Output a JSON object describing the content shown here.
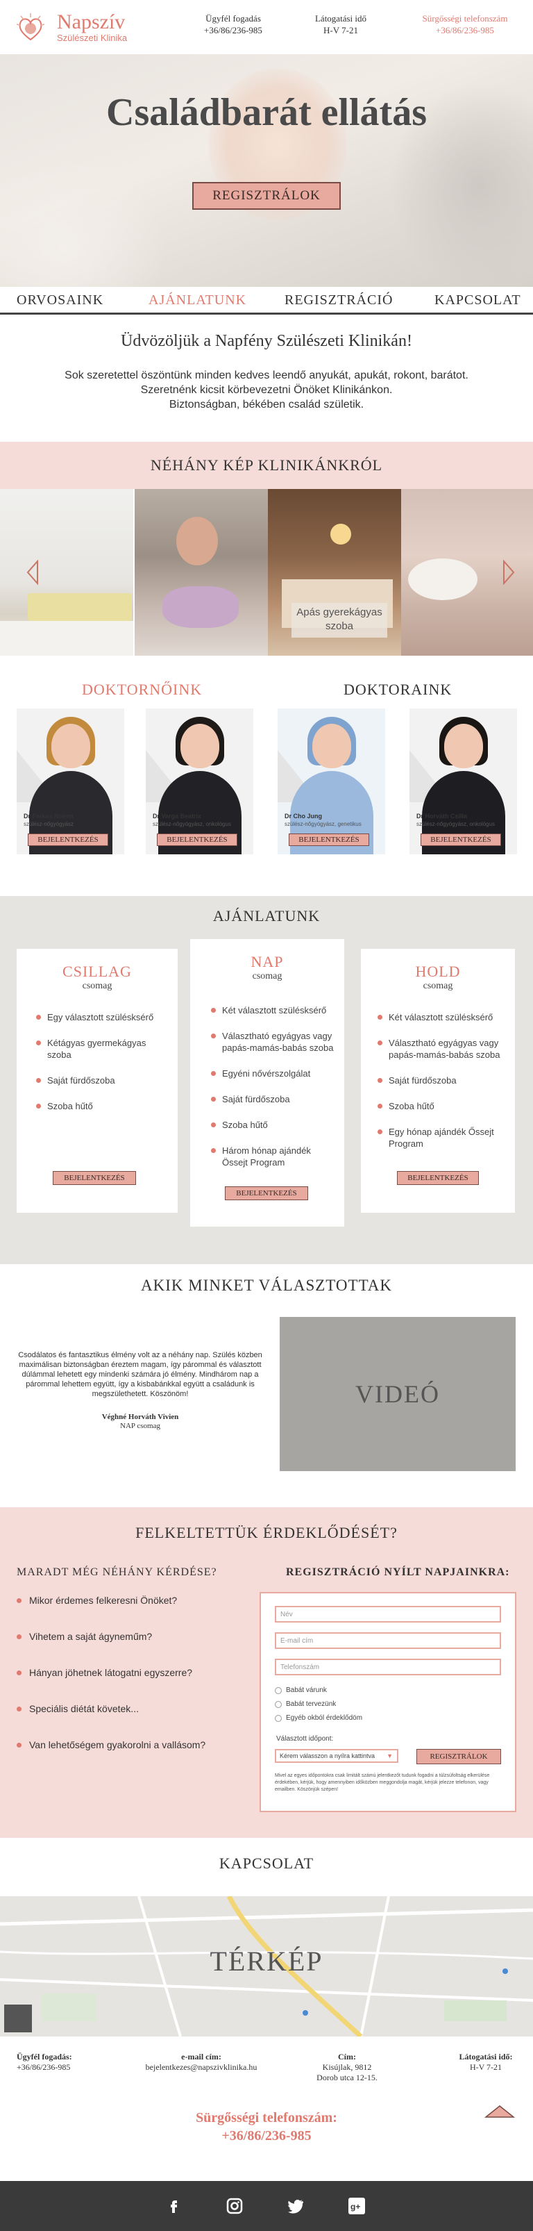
{
  "header": {
    "logo_name": "Napszív",
    "logo_sub": "Szülészeti Klinika",
    "reception_label": "Ügyfél fogadás",
    "reception_phone": "+36/86/236-985",
    "visiting_label": "Látogatási idő",
    "visiting_time": "H-V 7-21",
    "emergency_label": "Sürgősségi telefonszám",
    "emergency_phone": "+36/86/236-985"
  },
  "hero": {
    "title": "Családbarát ellátás",
    "button": "REGISZTRÁLOK"
  },
  "nav": {
    "items": [
      "ORVOSAINK",
      "AJÁNLATUNK",
      "REGISZTRÁCIÓ",
      "KAPCSOLAT"
    ],
    "active": "AJÁNLATUNK"
  },
  "welcome": {
    "title": "Üdvözöljük a Napfény Szülészeti Klinikán!",
    "line1": "Sok szeretettel öszöntünk minden kedves leendő anyukát, apukát, rokont, barátot.",
    "line2": "Szeretnénk kicsit körbevezetni Önöket Klinikánkon.",
    "line3": "Biztonságban, békében család születik."
  },
  "gallery": {
    "title": "NÉHÁNY KÉP KLINIKÁNKRÓL",
    "caption": "Apás gyerekágyas szoba"
  },
  "doctors": {
    "women_title": "DOKTORNŐINK",
    "men_title": "DOKTORAINK",
    "cards": [
      {
        "name": "Dr Farkas Noémi",
        "spec": "szülész-nőgyógyász",
        "button": "BEJELENTKEZÉS"
      },
      {
        "name": "Dr Varga Beatrix",
        "spec": "szülész-nőgyógyász, onkológus",
        "button": "BEJELENTKEZÉS"
      },
      {
        "name": "Dr Cho Jung",
        "spec": "szülész-nőgyógyász, genetikus",
        "button": "BEJELENTKEZÉS"
      },
      {
        "name": "Dr Horváth Csilla",
        "spec": "szülész-nőgyógyász, onkológus",
        "button": "BEJELENTKEZÉS"
      }
    ]
  },
  "offers": {
    "title": "AJÁNLATUNK",
    "packages": [
      {
        "name": "CSILLAG",
        "sub": "csomag",
        "items": [
          "Egy választott szülésksérő",
          "Kétágyas gyermekágyas szoba",
          "Saját fürdőszoba",
          "Szoba hűtő"
        ],
        "button": "BEJELENTKEZÉS"
      },
      {
        "name": "NAP",
        "sub": "csomag",
        "items": [
          "Két választott szülésksérő",
          "Választható egyágyas vagy papás-mamás-babás szoba",
          "Egyéni nővérszolgálat",
          "Saját fürdőszoba",
          "Szoba hűtő",
          "Három hónap ajándék Össejt Program"
        ],
        "button": "BEJELENTKEZÉS"
      },
      {
        "name": "HOLD",
        "sub": "csomag",
        "items": [
          "Két választott szülésksérő",
          "Választható egyágyas vagy papás-mamás-babás szoba",
          "Saját fürdőszoba",
          "Szoba hűtő",
          "Egy hónap ajándék Őssejt Program"
        ],
        "button": "BEJELENTKEZÉS"
      }
    ]
  },
  "testimonial": {
    "title": "AKIK MINKET VÁLASZTOTTAK",
    "quote": "Csodálatos és fantasztikus élmény volt az a néhány nap. Szülés közben maximálisan biztonságban éreztem magam, így párommal és választott dúlámmal lehetett egy mindenki számára jó élmény. Mindhárom nap a párommal lehettem együtt, így a kisbabánkkal együtt a családunk is megszülethetett. Köszönöm!",
    "author": "Véghné Horváth Vivien",
    "package": "NAP csomag",
    "video": "VIDEÓ"
  },
  "interest": {
    "title": "FELKELTETTÜK ÉRDEKLŐDÉSÉT?",
    "faq_title": "MARADT MÉG NÉHÁNY KÉRDÉSE?",
    "faq": [
      "Mikor érdemes felkeresni Önöket?",
      "Vihetem a saját ágyneműm?",
      "Hányan jöhetnek látogatni egyszerre?",
      "Speciális diétát követek...",
      "Van lehetőségem gyakorolni a vallásom?"
    ],
    "reg_title": "REGISZTRÁCIÓ NYÍLT NAPJAINKRA:",
    "form": {
      "name_placeholder": "Név",
      "email_placeholder": "E-mail cím",
      "phone_placeholder": "Telefonszám",
      "radio1": "Babát várunk",
      "radio2": "Babát tervezünk",
      "radio3": "Egyéb okból érdeklődöm",
      "time_label": "Választott időpont:",
      "select_value": "Kérem válasszon a nyílra kattintva",
      "submit": "REGISZTRÁLOK",
      "note": "Mivel az egyes időpontokra csak limitált számú jelentkezőt tudunk fogadni a túlzsúfoltság elkerülése érdekében, kérjük, hogy amennyiben időközben meggondolja magát, kérjük jelezze telefonon, vagy emailben. Köszönjük szépen!"
    }
  },
  "contact": {
    "title": "KAPCSOLAT",
    "map": "TÉRKÉP",
    "reception_label": "Ügyfél fogadás:",
    "reception_phone": "+36/86/236-985",
    "email_label": "e-mail cím:",
    "email": "bejelentkezes@napszivklinika.hu",
    "address_label": "Cím:",
    "address1": "Kisújlak, 9812",
    "address2": "Dorob utca 12-15.",
    "visiting_label": "Látogatási idő:",
    "visiting_time": "H-V 7-21",
    "urgent_label": "Sürgősségi telefonszám:",
    "urgent_phone": "+36/86/236-985"
  },
  "footer": {
    "icons": [
      "facebook-icon",
      "instagram-icon",
      "twitter-icon",
      "google-plus-icon"
    ]
  },
  "colors": {
    "accent": "#e07a6e",
    "button": "#e8a99e",
    "section_pink": "#f6dcd8",
    "section_gray": "#e6e4e0",
    "footer": "#3a3a3a"
  }
}
